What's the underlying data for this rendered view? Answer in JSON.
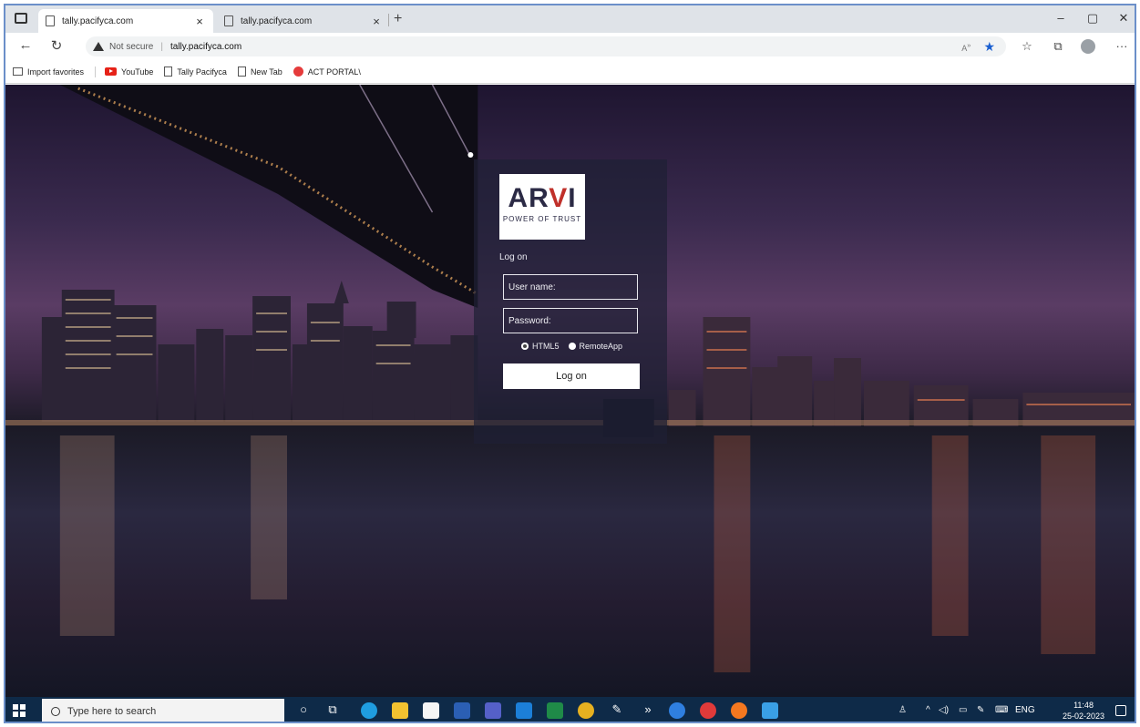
{
  "browser": {
    "tabs": [
      {
        "label": "tally.pacifyca.com",
        "close": "×"
      },
      {
        "label": "tally.pacifyca.com",
        "close": "×"
      }
    ],
    "new_tab": "+",
    "window_controls": {
      "minimize": "–",
      "restore": "▢",
      "close": "✕"
    },
    "address": {
      "security": "Not secure",
      "url": "tally.pacifyca.com"
    },
    "favorites": [
      {
        "label": "Import favorites",
        "icon": "folder-icon"
      },
      {
        "label": "YouTube",
        "icon": "youtube-icon"
      },
      {
        "label": "Tally Pacifyca",
        "icon": "page-icon"
      },
      {
        "label": "New Tab",
        "icon": "page-icon"
      },
      {
        "label": "ACT PORTAL\\",
        "icon": "act-portal-icon"
      }
    ],
    "toolbar_more": "···"
  },
  "login": {
    "logo_text_left": "AR",
    "logo_text_v": "V",
    "logo_text_right": "I",
    "logo_tagline": "POWER OF TRUST",
    "caption": "Log on",
    "username_placeholder": "User name:",
    "password_placeholder": "Password:",
    "radio_html5": "HTML5",
    "radio_remoteapp": "RemoteApp",
    "button": "Log on"
  },
  "taskbar": {
    "search_placeholder": "Type here to search",
    "language": "ENG",
    "time": "11:48",
    "date": "25-02-2023"
  }
}
